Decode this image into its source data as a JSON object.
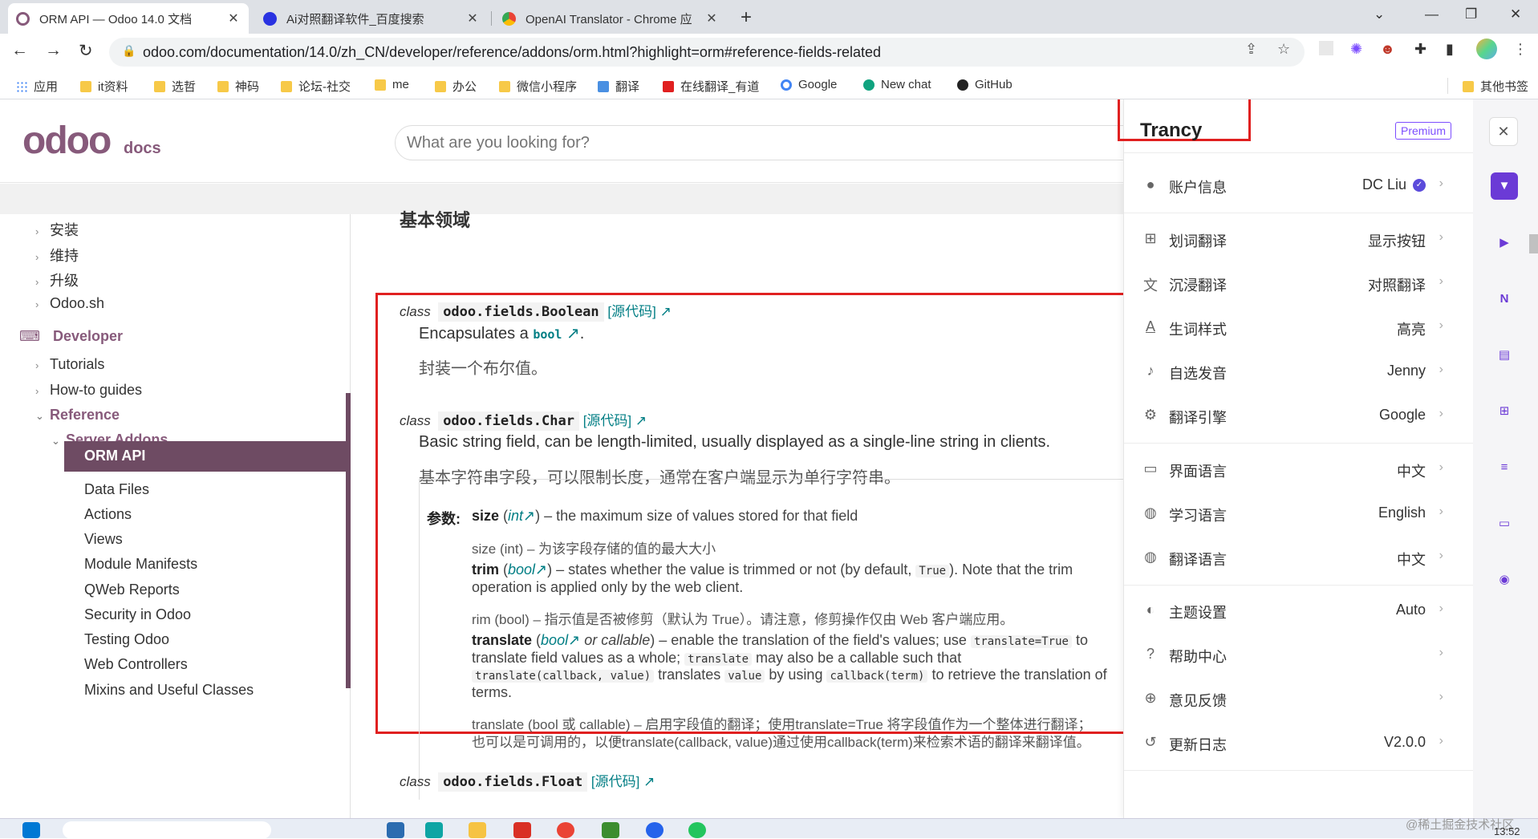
{
  "browser": {
    "tabs": [
      {
        "title": "ORM API — Odoo 14.0 文档",
        "active": true
      },
      {
        "title": "Ai对照翻译软件_百度搜索",
        "active": false
      },
      {
        "title": "OpenAI Translator - Chrome 应",
        "active": false
      }
    ],
    "url": "odoo.com/documentation/14.0/zh_CN/developer/reference/addons/orm.html?highlight=orm#reference-fields-related",
    "bookmarks": [
      "应用",
      "it资料",
      "选哲",
      "神码",
      "论坛-社交",
      "me",
      "办公",
      "微信小程序",
      "翻译",
      "在线翻译_有道",
      "Google",
      "New chat",
      "GitHub",
      "其他书签"
    ]
  },
  "site": {
    "logo": "odoo",
    "logo_suffix": "docs",
    "search_placeholder": "What are you looking for?",
    "section_heading": "基本领域"
  },
  "sidebar": {
    "top_items": [
      "安装",
      "维持",
      "升级",
      "Odoo.sh"
    ],
    "developer": "Developer",
    "dev_items": [
      "Tutorials",
      "How-to guides"
    ],
    "reference": "Reference",
    "server_addons": "Server Addons",
    "active": "ORM API",
    "sub_items": [
      "Data Files",
      "Actions",
      "Views",
      "Module Manifests",
      "QWeb Reports",
      "Security in Odoo",
      "Testing Odoo",
      "Web Controllers",
      "Mixins and Useful Classes"
    ]
  },
  "content": {
    "class_kw": "class",
    "source_label": "[源代码]",
    "boolean_sig": "odoo.fields.Boolean",
    "boolean_desc_a": "Encapsulates a",
    "boolean_desc_code": "bool",
    "boolean_desc_b": ".",
    "boolean_zh": "封装一个布尔值。",
    "char_sig": "odoo.fields.Char",
    "char_desc": "Basic string field, can be length-limited, usually displayed as a single-line string in clients.",
    "char_zh": "基本字符串字段，可以限制长度，通常在客户端显示为单行字符串。",
    "params_label": "参数:",
    "p_size_name": "size",
    "p_size_type": "int",
    "p_size_desc": ") – the maximum size of values stored for that field",
    "p_size_zh": "size (int) – 为该字段存储的值的最大大小",
    "p_trim_name": "trim",
    "p_trim_type": "bool",
    "p_trim_desc1": ") – states whether the value is trimmed or not (by default,",
    "p_trim_code": "True",
    "p_trim_desc2": "). Note that the trim",
    "p_trim_desc3": "operation is applied only by the web client.",
    "p_trim_zh": "rim (bool) – 指示值是否被修剪（默认为 True）。请注意，修剪操作仅由 Web 客户端应用。",
    "p_tr_name": "translate",
    "p_tr_type": "bool",
    "p_tr_or": "or callable",
    "p_tr_desc1": ") – enable the translation of the field's values; use",
    "p_tr_code1": "translate=True",
    "p_tr_to": "to",
    "p_tr_desc2": "translate field values as a whole;",
    "p_tr_code2": "translate",
    "p_tr_desc3": "may also be a callable such that",
    "p_tr_code3": "translate(callback, value)",
    "p_tr_desc4": "translates",
    "p_tr_code4": "value",
    "p_tr_desc5": "by using",
    "p_tr_code5": "callback(term)",
    "p_tr_desc6": "to retrieve the translation of",
    "p_tr_desc7": "terms.",
    "p_tr_zh1": "translate (bool 或 callable) – 启用字段值的翻译；使用translate=True 将字段值作为一个整体进行翻译；",
    "p_tr_zh2": "也可以是可调用的，以便translate(callback, value)通过使用callback(term)来检索术语的翻译来翻译值。",
    "float_sig": "odoo.fields.Float"
  },
  "trancy": {
    "title": "Trancy",
    "premium": "Premium",
    "rows": [
      {
        "label": "账户信息",
        "value": "DC Liu",
        "icon": "user-icon"
      },
      {
        "label": "划词翻译",
        "value": "显示按钮",
        "icon": "select-translate-icon"
      },
      {
        "label": "沉浸翻译",
        "value": "对照翻译",
        "icon": "translate-icon"
      },
      {
        "label": "生词样式",
        "value": "高亮",
        "icon": "text-style-icon"
      },
      {
        "label": "自选发音",
        "value": "Jenny",
        "icon": "voice-icon"
      },
      {
        "label": "翻译引擎",
        "value": "Google",
        "icon": "engine-icon"
      },
      {
        "label": "界面语言",
        "value": "中文",
        "icon": "interface-icon"
      },
      {
        "label": "学习语言",
        "value": "English",
        "icon": "globe-icon"
      },
      {
        "label": "翻译语言",
        "value": "中文",
        "icon": "globe-icon"
      },
      {
        "label": "主题设置",
        "value": "Auto",
        "icon": "palette-icon"
      },
      {
        "label": "帮助中心",
        "value": "",
        "icon": "help-icon"
      },
      {
        "label": "意见反馈",
        "value": "",
        "icon": "feedback-icon"
      },
      {
        "label": "更新日志",
        "value": "V2.0.0",
        "icon": "history-icon"
      }
    ]
  },
  "taskbar": {
    "time": "13:52",
    "watermark": "@稀土掘金技术社区"
  },
  "colors": {
    "brand": "#875a7b",
    "active_nav": "#6e4b63",
    "link": "#017e84",
    "highlight_box": "#e02020",
    "trancy_accent": "#7c4dff"
  }
}
